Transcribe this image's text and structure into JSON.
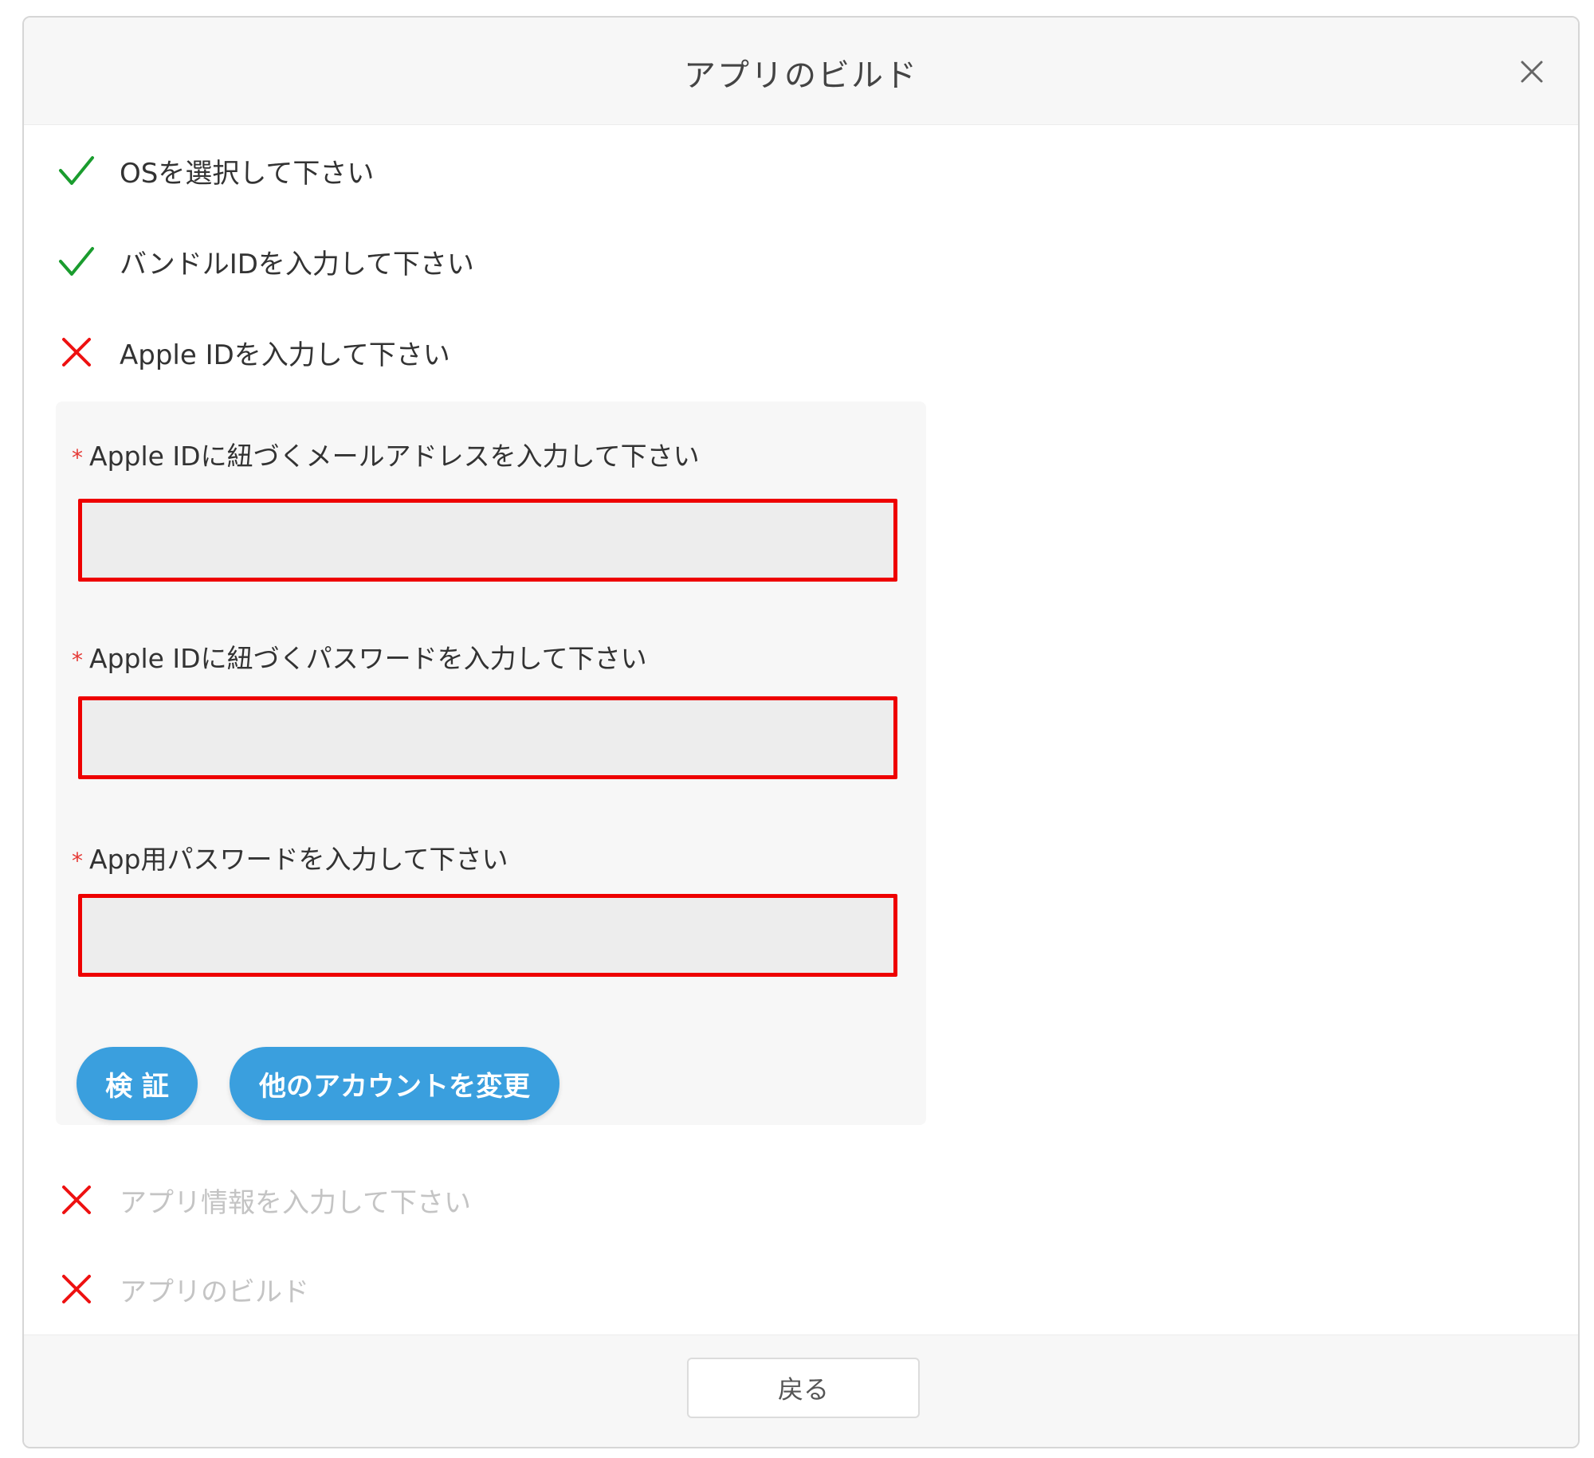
{
  "dialog": {
    "title": "アプリのビルド",
    "close_icon": "close-icon"
  },
  "steps": [
    {
      "label": "OSを選択して下さい",
      "status": "done",
      "icon": "check-icon",
      "color": "#1a9c2e"
    },
    {
      "label": "バンドルIDを入力して下さい",
      "status": "done",
      "icon": "check-icon",
      "color": "#1a9c2e"
    },
    {
      "label": "Apple IDを入力して下さい",
      "status": "error",
      "icon": "cross-icon",
      "color": "#ee1111"
    },
    {
      "label": "アプリ情報を入力して下さい",
      "status": "pending",
      "icon": "cross-icon",
      "color": "#ee1111"
    },
    {
      "label": "アプリのビルド",
      "status": "pending",
      "icon": "cross-icon",
      "color": "#ee1111"
    }
  ],
  "form": {
    "required_mark": "*",
    "fields": [
      {
        "label": "Apple IDに紐づくメールアドレスを入力して下さい",
        "value": "",
        "placeholder": ""
      },
      {
        "label": "Apple IDに紐づくパスワードを入力して下さい",
        "value": "",
        "placeholder": ""
      },
      {
        "label": "App用パスワードを入力して下さい",
        "value": "",
        "placeholder": ""
      }
    ],
    "verify_button": "検 証",
    "change_account_button": "他のアカウントを変更"
  },
  "footer": {
    "back_button": "戻る"
  },
  "colors": {
    "accent": "#3a9fde",
    "error": "#ee0000",
    "success": "#1a9c2e"
  }
}
